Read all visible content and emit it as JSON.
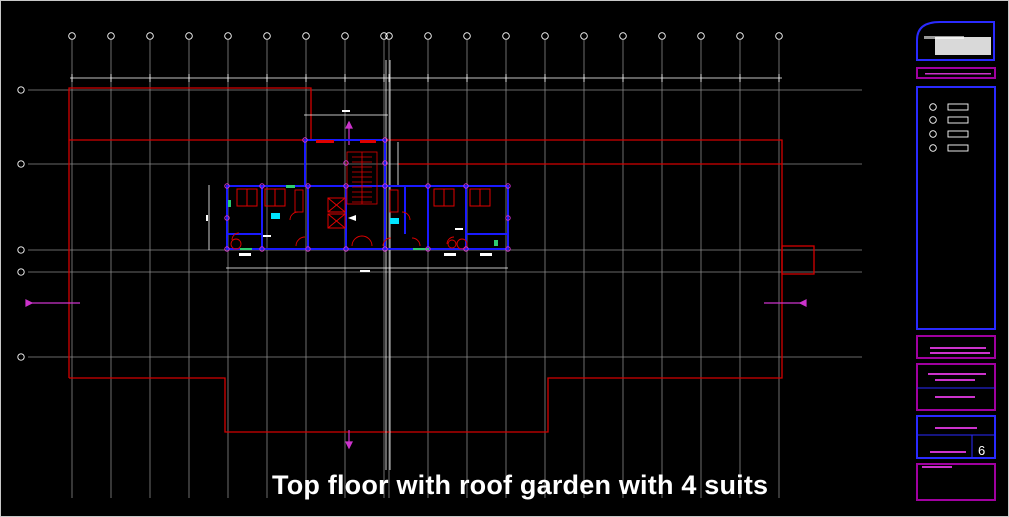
{
  "caption": "Top floor with roof garden with 4 suits",
  "sheet": {
    "number": "6"
  },
  "colors": {
    "background": "#000000",
    "grid": "#8a8a8a",
    "boundary": "#d40000",
    "walls": "#1a1aff",
    "rooms": "#e00000",
    "markers": "#cc33cc",
    "accent_green": "#2ecc71",
    "accent_cyan": "#00e5ff",
    "titleblock": "#2a2aff",
    "titleblock_magenta": "#a000a0"
  },
  "icons": [
    "grid-bubble-icon",
    "section-marker-icon",
    "north-arrow-icon"
  ]
}
